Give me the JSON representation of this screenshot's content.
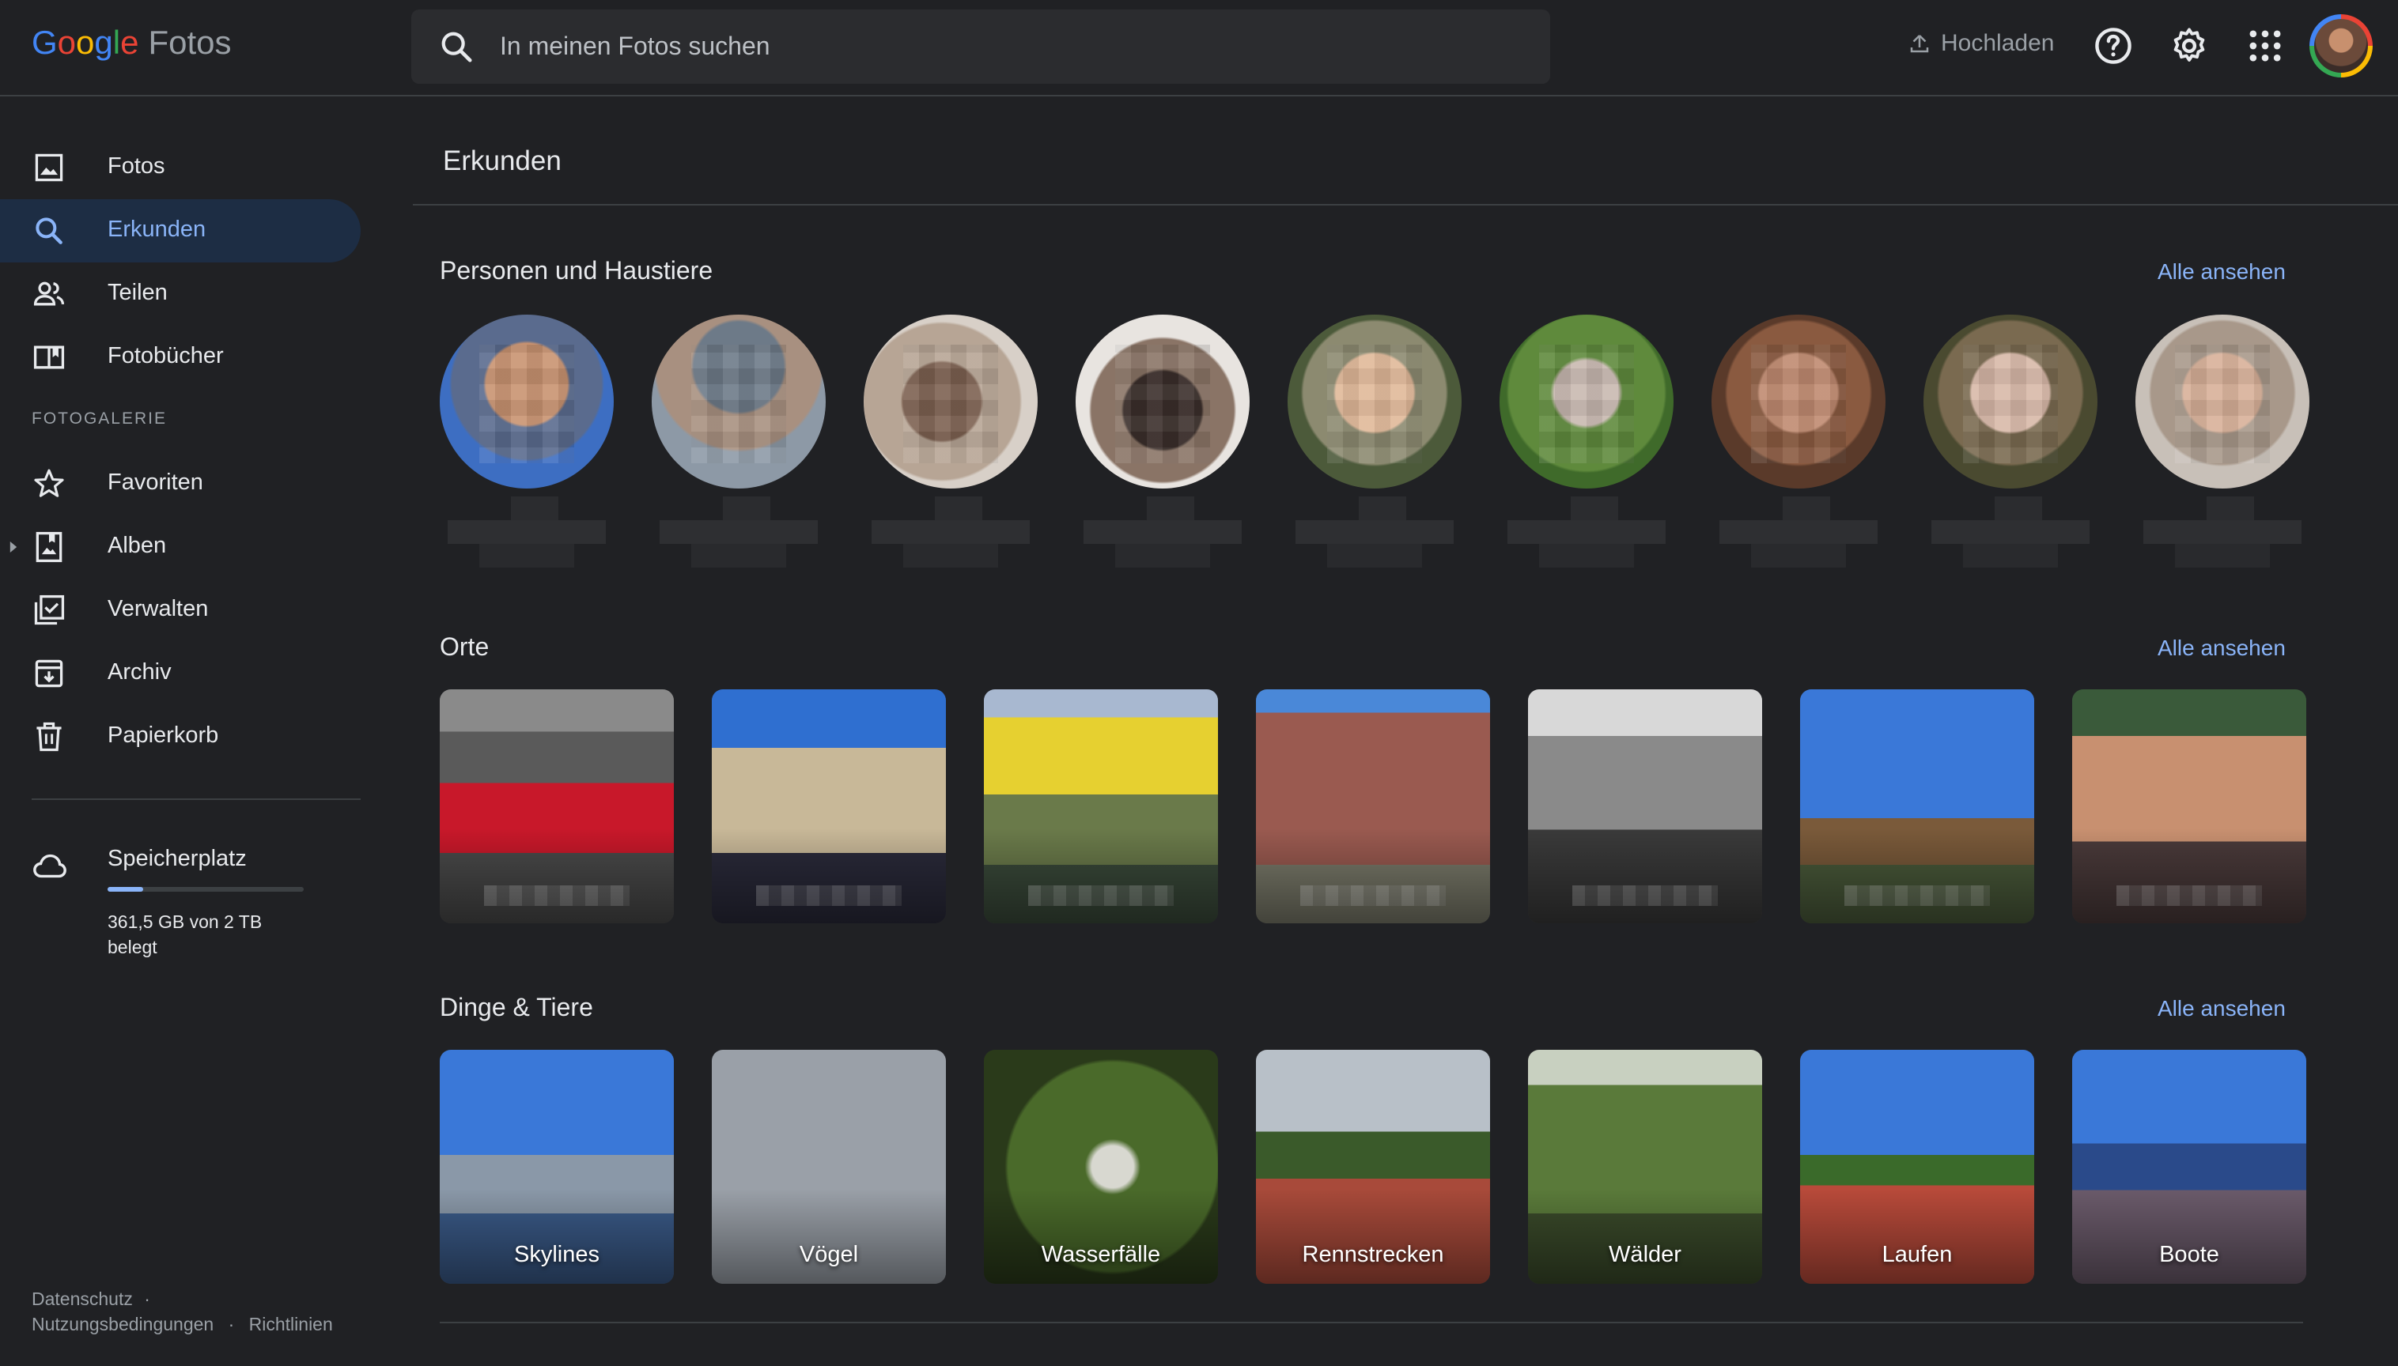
{
  "header": {
    "logo_google": "Google",
    "logo_product": "Fotos",
    "search_placeholder": "In meinen Fotos suchen",
    "upload_label": "Hochladen",
    "icons": [
      "help-icon",
      "settings-icon",
      "apps-grid-icon"
    ]
  },
  "sidebar": {
    "items": [
      {
        "label": "Fotos",
        "icon": "photo-icon",
        "active": false
      },
      {
        "label": "Erkunden",
        "icon": "search-icon",
        "active": true
      },
      {
        "label": "Teilen",
        "icon": "people-icon",
        "active": false
      },
      {
        "label": "Fotobücher",
        "icon": "book-icon",
        "active": false
      }
    ],
    "section_title": "FOTOGALERIE",
    "gallery_items": [
      {
        "label": "Favoriten",
        "icon": "star-icon"
      },
      {
        "label": "Alben",
        "icon": "album-icon"
      },
      {
        "label": "Verwalten",
        "icon": "manage-icon"
      },
      {
        "label": "Archiv",
        "icon": "archive-icon"
      },
      {
        "label": "Papierkorb",
        "icon": "trash-icon"
      }
    ],
    "storage": {
      "label": "Speicherplatz",
      "text": "361,5 GB von 2 TB belegt",
      "used_fraction": 0.18
    },
    "footer": {
      "privacy": "Datenschutz",
      "terms": "Nutzungsbedingungen",
      "policies": "Richtlinien",
      "separator": "·"
    }
  },
  "main": {
    "title": "Erkunden",
    "people": {
      "title": "Personen und Haustiere",
      "see_all": "Alle ansehen",
      "count": 9
    },
    "places": {
      "title": "Orte",
      "see_all": "Alle ansehen",
      "count": 7
    },
    "things": {
      "title": "Dinge & Tiere",
      "see_all": "Alle ansehen",
      "items": [
        "Skylines",
        "Vögel",
        "Wasserfälle",
        "Rennstrecken",
        "Wälder",
        "Laufen",
        "Boote"
      ]
    }
  },
  "colors": {
    "background": "#202124",
    "accent": "#8ab4f8",
    "active_nav_bg": "#1d2d44",
    "text": "#e8eaed",
    "muted": "#9aa0a6"
  }
}
